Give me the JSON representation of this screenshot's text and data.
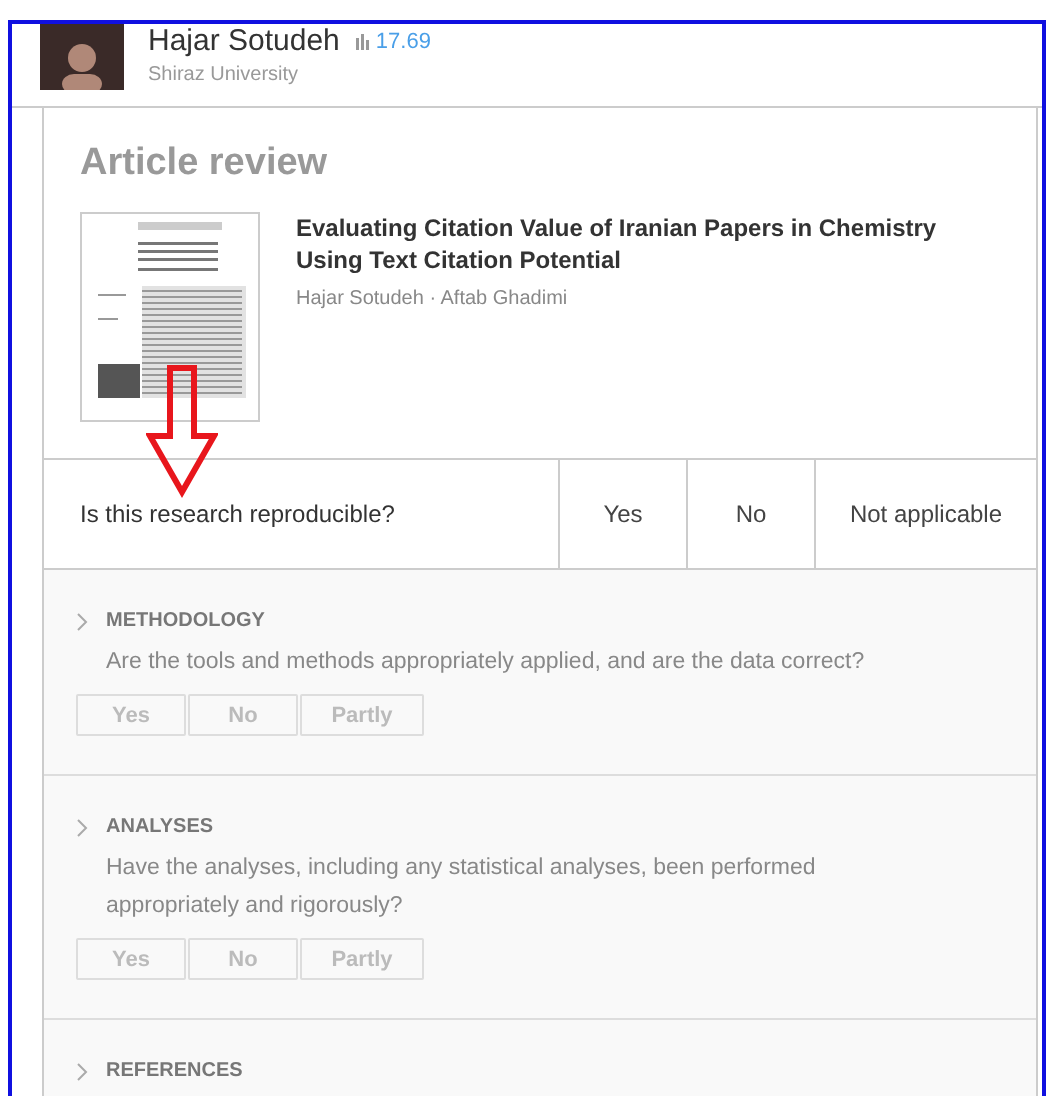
{
  "profile": {
    "name": "Hajar Sotudeh",
    "score": "17.69",
    "affiliation": "Shiraz University"
  },
  "review": {
    "heading": "Article review",
    "article": {
      "title": "Evaluating Citation Value of Iranian Papers in Chemistry Using Text Citation Potential",
      "authors": "Hajar Sotudeh · Aftab Ghadimi"
    },
    "reproducible": {
      "question": "Is this research reproducible?",
      "options": [
        {
          "label": "Yes",
          "selected": false
        },
        {
          "label": "No",
          "selected": false
        },
        {
          "label": "Not applicable",
          "selected": false
        }
      ]
    },
    "sections": [
      {
        "title": "METHODOLOGY",
        "expanded": false,
        "question": "Are the tools and methods appropriately applied, and are the data correct?",
        "answers": [
          {
            "label": "Yes",
            "selected": false
          },
          {
            "label": "No",
            "selected": false
          },
          {
            "label": "Partly",
            "selected": false
          }
        ]
      },
      {
        "title": "ANALYSES",
        "expanded": false,
        "question": "Have the analyses, including any statistical analyses, been performed appropriately and rigorously?",
        "answers": [
          {
            "label": "Yes",
            "selected": false
          },
          {
            "label": "No",
            "selected": false
          },
          {
            "label": "Partly",
            "selected": false
          }
        ]
      },
      {
        "title": "REFERENCES",
        "expanded": false
      }
    ]
  }
}
